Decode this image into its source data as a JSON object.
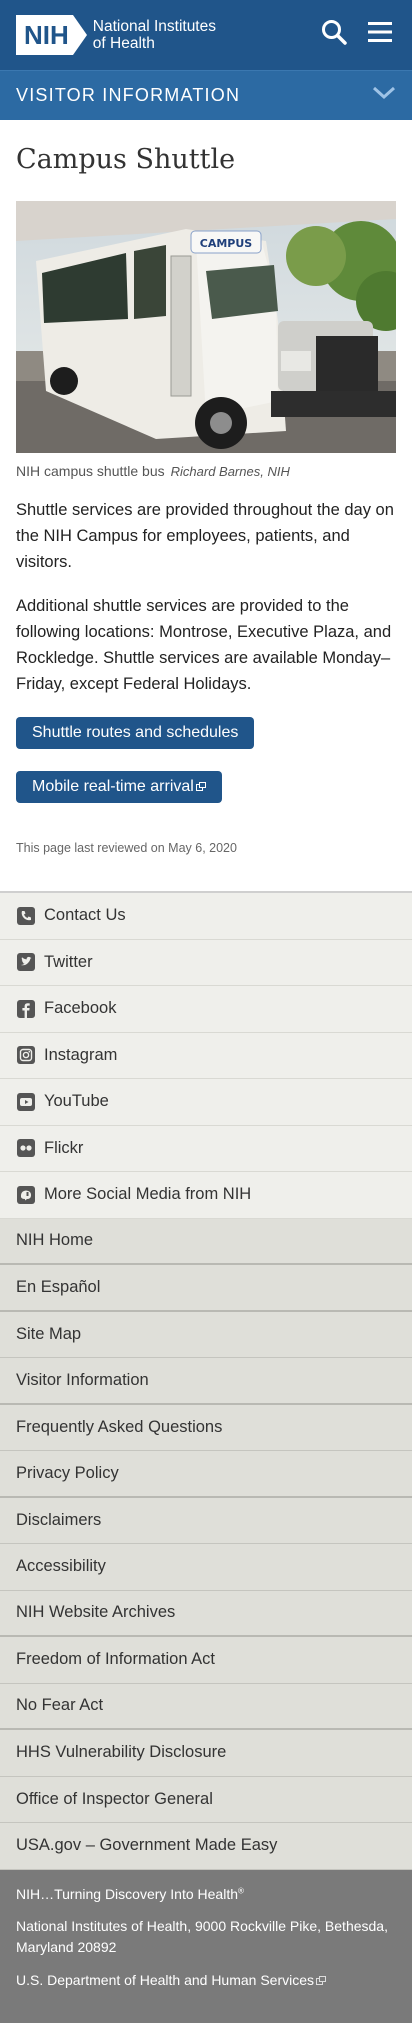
{
  "header": {
    "logo_badge": "NIH",
    "logo_line1": "National Institutes",
    "logo_line2": "of Health"
  },
  "visitor_bar": {
    "label": "VISITOR INFORMATION"
  },
  "main": {
    "title": "Campus Shuttle",
    "photo_sign": "CAMPUS",
    "caption": "NIH campus shuttle bus",
    "credit": "Richard Barnes, NIH",
    "para1": "Shuttle services are provided throughout the day on the NIH Campus for employees, patients, and visitors.",
    "para2": "Additional shuttle services are provided to the following locations: Montrose, Executive Plaza, and Rockledge. Shuttle services are available Monday–Friday, except Federal Holidays.",
    "btn_routes": "Shuttle routes and schedules",
    "btn_mobile": "Mobile real-time arrival",
    "reviewed": "This page last reviewed on May 6, 2020"
  },
  "social": [
    {
      "label": "Contact Us",
      "icon": "phone-icon"
    },
    {
      "label": "Twitter",
      "icon": "twitter-icon"
    },
    {
      "label": "Facebook",
      "icon": "facebook-icon"
    },
    {
      "label": "Instagram",
      "icon": "instagram-icon"
    },
    {
      "label": "YouTube",
      "icon": "youtube-icon"
    },
    {
      "label": "Flickr",
      "icon": "flickr-icon"
    },
    {
      "label": "More Social Media from NIH",
      "icon": "social-media-icon"
    }
  ],
  "nav": [
    "NIH Home",
    "En Español",
    "Site Map",
    "Visitor Information",
    "Frequently Asked Questions",
    "Privacy Policy",
    "Disclaimers",
    "Accessibility",
    "NIH Website Archives",
    "Freedom of Information Act",
    "No Fear Act",
    "HHS Vulnerability Disclosure",
    "Office of Inspector General",
    "USA.gov – Government Made Easy"
  ],
  "bottom": {
    "tagline": "NIH…Turning Discovery Into Health",
    "tagline_mark": "®",
    "address": "National Institutes of Health, 9000 Rockville Pike, Bethesda, Maryland 20892",
    "hhs": "U.S. Department of Health and Human Services"
  },
  "colors": {
    "header_bg": "#20558a",
    "visitor_bar_bg": "#2c6aa3",
    "button_bg": "#20558a",
    "social_bg": "#efefeb",
    "nav_bg": "#dfdfd9",
    "bottom_bg": "#7a7a7a"
  }
}
